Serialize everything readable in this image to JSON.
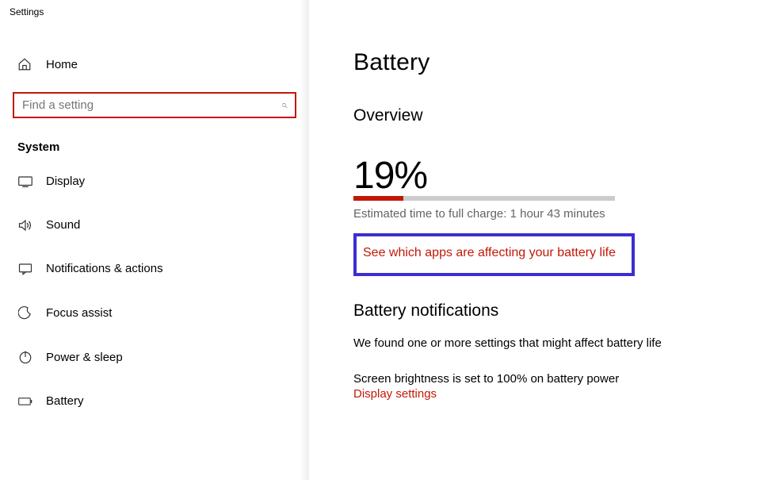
{
  "app": {
    "title": "Settings"
  },
  "sidebar": {
    "home_label": "Home",
    "search_placeholder": "Find a setting",
    "section_heading": "System",
    "items": [
      {
        "label": "Display"
      },
      {
        "label": "Sound"
      },
      {
        "label": "Notifications & actions"
      },
      {
        "label": "Focus assist"
      },
      {
        "label": "Power & sleep"
      },
      {
        "label": "Battery"
      }
    ]
  },
  "main": {
    "title": "Battery",
    "overview_heading": "Overview",
    "percent": "19%",
    "progress_percent": 19,
    "estimate": "Estimated time to full charge: 1 hour 43 minutes",
    "apps_link": "See which apps are affecting your battery life",
    "notif_heading": "Battery notifications",
    "notif_text": "We found one or more settings that might affect battery life",
    "brightness_text": "Screen brightness is set to 100% on battery power",
    "display_link": "Display settings"
  }
}
